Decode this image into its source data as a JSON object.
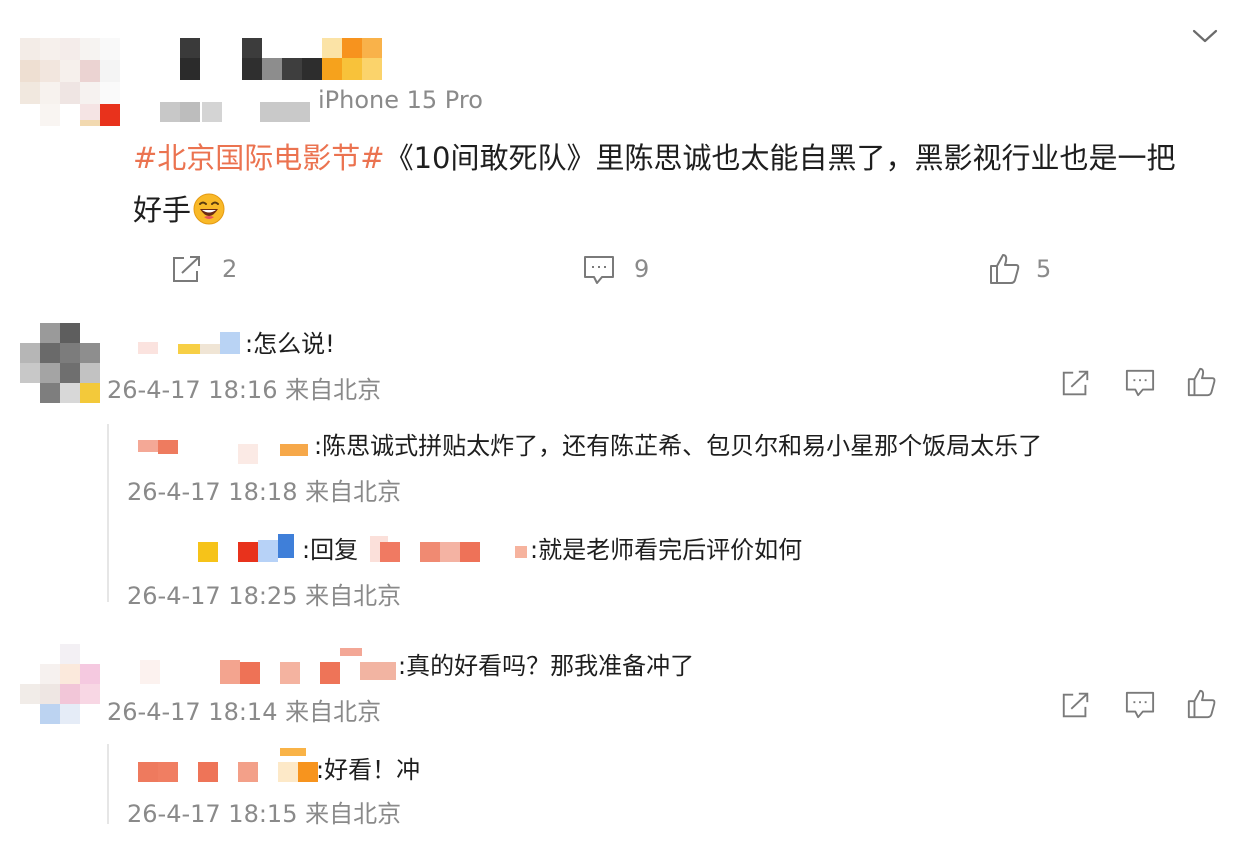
{
  "post": {
    "device": "iPhone 15 Pro",
    "hashtag": "#北京国际电影节#",
    "text_line1": "《10间敢死队》里陈思诚也太能自黑了，黑影视行业也是一把",
    "text_line2": "好手",
    "emoji": "laugh-emoji",
    "repost_count": "2",
    "comment_count": "9",
    "like_count": "5"
  },
  "comments": [
    {
      "text": ":怎么说!",
      "meta": "26-4-17 18:16 来自北京",
      "replies": [
        {
          "text": ":陈思诚式拼贴太炸了，还有陈芷希、包贝尔和易小星那个饭局太乐了",
          "meta": "26-4-17 18:18 来自北京"
        },
        {
          "prefix": ":回复",
          "text": ":就是老师看完后评价如何",
          "meta": "26-4-17 18:25 来自北京"
        }
      ]
    },
    {
      "text": ":真的好看吗？那我准备冲了",
      "meta": "26-4-17 18:14 来自北京",
      "replies": [
        {
          "text": ":好看！冲",
          "meta": "26-4-17 18:15 来自北京"
        }
      ]
    }
  ],
  "colors": {
    "hashtag": "#eb7350",
    "meta": "#8a8a8a",
    "text": "#1e1e1e"
  }
}
